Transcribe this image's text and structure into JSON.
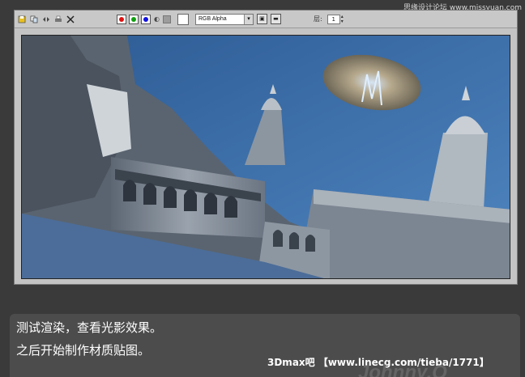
{
  "watermark": {
    "text": "思缘设计论坛 www.missyuan.com"
  },
  "toolbar": {
    "icons": [
      "save-icon",
      "copy-icon",
      "clone-icon",
      "print-icon",
      "clear-icon"
    ],
    "color_channels": [
      {
        "name": "red-channel",
        "color": "#e01010"
      },
      {
        "name": "green-channel",
        "color": "#10a010"
      },
      {
        "name": "blue-channel",
        "color": "#1010e0"
      }
    ],
    "channel_select": "RGB Alpha",
    "layer_label": "层:",
    "layer_value": "1"
  },
  "render": {
    "sky_color": "#2f5a8f",
    "stone_color": "#7a8592"
  },
  "caption": {
    "line1": "测试渲染，查看光影效果。",
    "line2": "之后开始制作材质贴图。",
    "credit": "3Dmax吧 【www.linecg.com/tieba/1771】",
    "signature": "Johnny.Q"
  }
}
